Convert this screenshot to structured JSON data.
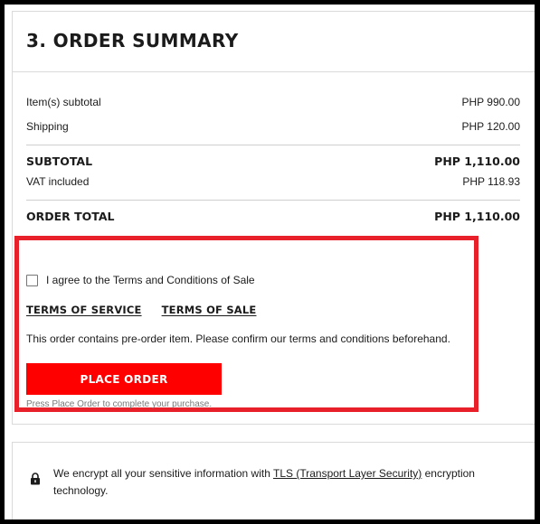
{
  "order_summary": {
    "title": "3. ORDER SUMMARY",
    "items_subtotal_label": "Item(s) subtotal",
    "items_subtotal_value": "PHP 990.00",
    "shipping_label": "Shipping",
    "shipping_value": "PHP 120.00",
    "subtotal_label": "SUBTOTAL",
    "subtotal_value": "PHP 1,110.00",
    "vat_label": "VAT included",
    "vat_value": "PHP 118.93",
    "order_total_label": "ORDER TOTAL",
    "order_total_value": "PHP 1,110.00"
  },
  "agreement": {
    "checkbox_label": "I agree to the Terms and Conditions of Sale",
    "checked": false,
    "terms_of_service": "TERMS OF SERVICE",
    "terms_of_sale": "TERMS OF SALE",
    "preorder_note": "This order contains pre-order item. Please confirm our terms and conditions beforehand.",
    "place_order_label": "PLACE ORDER",
    "place_order_hint": "Press Place Order to complete your purchase."
  },
  "security": {
    "icon": "lock-icon",
    "text_before": "We encrypt all your sensitive information with ",
    "tls_link": "TLS (Transport Layer Security)",
    "text_after": " encryption technology."
  },
  "colors": {
    "accent": "#ff0000",
    "highlight_border": "#e8202a",
    "divider": "#cfcfcf"
  }
}
